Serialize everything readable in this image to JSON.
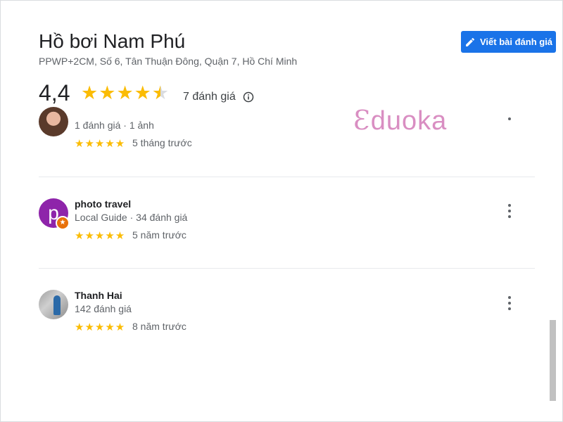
{
  "place": {
    "title": "Hồ bơi Nam Phú",
    "address": "PPWP+2CM, Số 6, Tân Thuận Đông, Quận 7, Hồ Chí Minh"
  },
  "write_review": {
    "label": "Viết bài đánh giá",
    "icon": "pencil-icon",
    "color": "#1a73e8"
  },
  "summary": {
    "rating": "4,4",
    "rating_value": 4.4,
    "stars_max": 5,
    "count_text": "7 đánh giá",
    "info_icon": "info-icon"
  },
  "watermark": {
    "mark": "Ɛ",
    "text": "duoka",
    "color": "#d98ec2"
  },
  "reviews": [
    {
      "name": "",
      "meta": "1 đánh giá · 1 ảnh",
      "stars": "★★★★★",
      "rating": 5,
      "when": "5 tháng trước",
      "avatar": "photo"
    },
    {
      "name": "photo travel",
      "meta": "Local Guide · 34 đánh giá",
      "stars": "★★★★★",
      "rating": 5,
      "when": "5 năm trước",
      "avatar_letter": "p",
      "badge": "★"
    },
    {
      "name": "Thanh Hai",
      "meta": "142 đánh giá",
      "stars": "★★★★★",
      "rating": 5,
      "when": "8 năm trước",
      "avatar": "photo"
    }
  ],
  "colors": {
    "star": "#fbbc04",
    "text_secondary": "#5f6368",
    "avatar_purple": "#8e24aa"
  }
}
